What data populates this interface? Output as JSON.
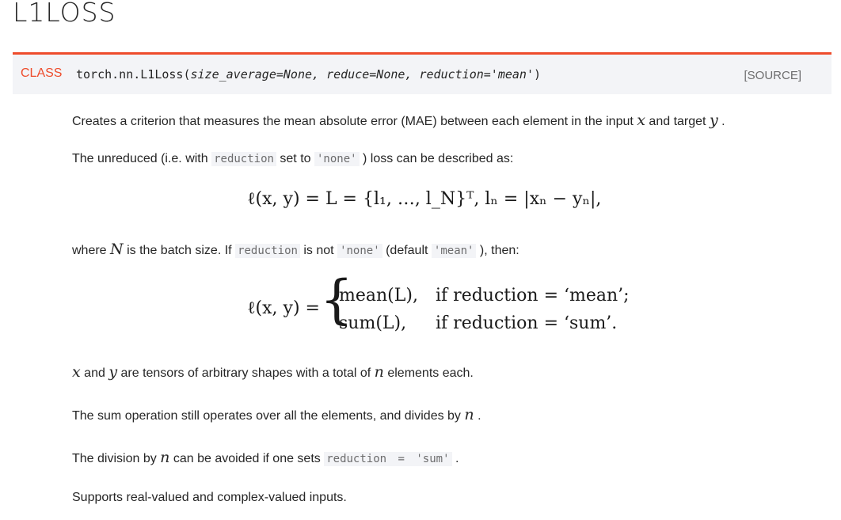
{
  "title": "L1LOSS",
  "signature": {
    "class_label": "CLASS",
    "name": "torch.nn.L1Loss(",
    "params": "size_average=None, reduce=None, reduction='mean'",
    "close": ")",
    "source": "[SOURCE]"
  },
  "p1": {
    "text_a": "Creates a criterion that measures the mean absolute error (MAE) between each element in the input ",
    "x": "x",
    "text_b": " and target ",
    "y": "y",
    "text_c": " ."
  },
  "p2": {
    "text_a": "The unreduced (i.e. with ",
    "code_a": "reduction",
    "text_b": " set to ",
    "code_b": "'none'",
    "text_c": " ) loss can be described as:"
  },
  "eq1": "ℓ(x, y) = L = {l₁, …, l_N}ᵀ,   lₙ = |xₙ − yₙ|,",
  "p3": {
    "text_a": "where ",
    "N": "N",
    "text_b": " is the batch size. If ",
    "code_a": "reduction",
    "text_c": " is not ",
    "code_b": "'none'",
    "text_d": " (default ",
    "code_c": "'mean'",
    "text_e": " ), then:"
  },
  "eq2": {
    "lhs": "ℓ(x, y) =",
    "row1_a": "mean(L),",
    "row1_b": "if reduction = ‘mean’;",
    "row2_a": "sum(L),",
    "row2_b": "if reduction = ‘sum’."
  },
  "p4": {
    "x": "x",
    "text_a": " and ",
    "y": "y",
    "text_b": " are tensors of arbitrary shapes with a total of ",
    "n": "n",
    "text_c": " elements each."
  },
  "p5": {
    "text_a": "The sum operation still operates over all the elements, and divides by ",
    "n": "n",
    "text_b": " ."
  },
  "p6": {
    "text_a": "The division by ",
    "n": "n",
    "text_b": " can be avoided if one sets ",
    "code_a": "reduction",
    "eq": " = ",
    "code_b": "'sum'",
    "text_c": " ."
  },
  "p7": {
    "text": "Supports real-valued and complex-valued inputs."
  }
}
